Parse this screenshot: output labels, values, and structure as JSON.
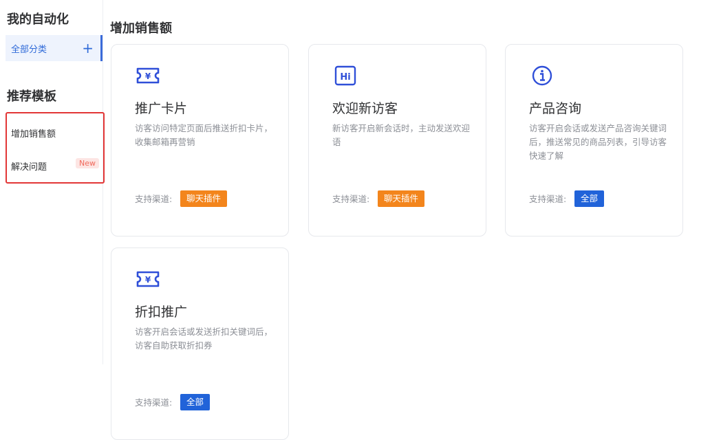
{
  "colors": {
    "accent": "#2f6ad8",
    "orange_tag": "#f3851c",
    "blue_tag": "#2163d9",
    "highlight_border": "#e23535",
    "new_badge_bg": "#fde5e3",
    "new_badge_text": "#f06a5c"
  },
  "sidebar": {
    "my_automation_title": "我的自动化",
    "all_categories_label": "全部分类",
    "add_icon": "+",
    "recommended_title": "推荐模板",
    "items": [
      {
        "label": "增加销售额"
      },
      {
        "label": "解决问题",
        "badge": "New"
      }
    ]
  },
  "main": {
    "section_title": "增加销售额",
    "cards": [
      {
        "icon": "ticket-icon",
        "title": "推广卡片",
        "desc": "访客访问特定页面后推送折扣卡片，收集邮箱再营销",
        "channel_label": "支持渠道:",
        "tag": "聊天插件",
        "tag_color": "orange"
      },
      {
        "icon": "hi-icon",
        "title": "欢迎新访客",
        "desc": "新访客开启新会话时，主动发送欢迎语",
        "channel_label": "支持渠道:",
        "tag": "聊天插件",
        "tag_color": "orange"
      },
      {
        "icon": "info-icon",
        "title": "产品咨询",
        "desc": "访客开启会话或发送产品咨询关键词后，推送常见的商品列表，引导访客快速了解",
        "channel_label": "支持渠道:",
        "tag": "全部",
        "tag_color": "blue"
      },
      {
        "icon": "ticket-icon",
        "title": "折扣推广",
        "desc": "访客开启会话或发送折扣关键词后，访客自助获取折扣券",
        "channel_label": "支持渠道:",
        "tag": "全部",
        "tag_color": "blue"
      }
    ]
  }
}
